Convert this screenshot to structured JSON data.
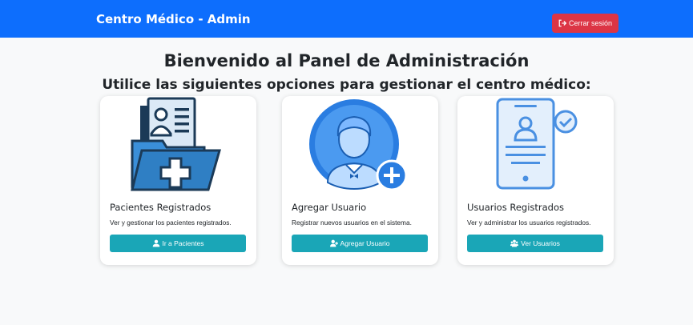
{
  "navbar": {
    "brand": "Centro Médico - Admin",
    "logout_label": "Cerrar sesión",
    "logout_icon": "sign-out-icon"
  },
  "main": {
    "title": "Bienvenido al Panel de Administración",
    "subtitle": "Utilice las siguientes opciones para gestionar el centro médico:"
  },
  "cards": [
    {
      "illustration": "patient-folder-illustration",
      "title": "Pacientes Registrados",
      "text": "Ver y gestionar los pacientes registrados.",
      "button_label": "Ir a Pacientes",
      "button_icon": "user-icon"
    },
    {
      "illustration": "add-user-illustration",
      "title": "Agregar Usuario",
      "text": "Registrar nuevos usuarios en el sistema.",
      "button_label": "Agregar Usuario",
      "button_icon": "user-plus-icon"
    },
    {
      "illustration": "user-id-card-illustration",
      "title": "Usuarios Registrados",
      "text": "Ver y administrar los usuarios registrados.",
      "button_label": "Ver Usuarios",
      "button_icon": "users-icon"
    }
  ],
  "colors": {
    "navbar": "#0d6efd",
    "logout_button": "#dc3545",
    "card_button": "#1aa6b7",
    "background": "#f8f9fa"
  }
}
